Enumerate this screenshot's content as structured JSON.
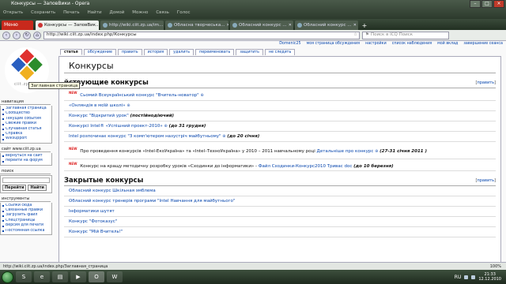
{
  "window": {
    "title": "Конкурсы — ЗаповВики - Opera",
    "controls": [
      "–",
      "□",
      "×"
    ]
  },
  "ghost_toolbar": [
    "Открыть",
    "Сохранить",
    "Печать",
    "Найти",
    "Домой",
    "Можно",
    "Связь",
    "Голос"
  ],
  "tabbar": {
    "menu_label": "Меню",
    "tabs": [
      {
        "label": "Конкурсы — ЗаповВик...",
        "active": true
      },
      {
        "label": "http://wiki.ciit.zp.ua/im...",
        "active": false
      },
      {
        "label": "Обласна творчеська...",
        "active": false
      },
      {
        "label": "Обласний конкурс ...",
        "active": false
      },
      {
        "label": "Обласний конкурс ...",
        "active": false
      }
    ],
    "new_tab": "+"
  },
  "addressbar": {
    "url": "http://wiki.ciit.zp.ua/index.php/Конкурсы",
    "search_placeholder": "Поиск в ICQ Поиск"
  },
  "personal_links": [
    "Domenic25",
    "моя страница обсуждения",
    "настройки",
    "список наблюдения",
    "мой вклад",
    "завершение сеанса"
  ],
  "logo": {
    "brand": "ciit.zp.ua"
  },
  "tooltip": "Заглавная страница",
  "content_tabs": [
    {
      "label": "статья",
      "selected": true
    },
    {
      "label": "обсуждение",
      "selected": false
    },
    {
      "label": "править",
      "selected": false
    },
    {
      "label": "история",
      "selected": false
    },
    {
      "label": "удалить",
      "selected": false
    },
    {
      "label": "переименовать",
      "selected": false
    },
    {
      "label": "защитить",
      "selected": false
    },
    {
      "label": "не следить",
      "selected": false
    }
  ],
  "sidebar": {
    "navigation": {
      "title": "навигация",
      "items": [
        "Заглавная страница",
        "Сообщество",
        "Текущие события",
        "Свежие правки",
        "Случайная статья",
        "Справка",
        "Wiksupport"
      ]
    },
    "site": {
      "title": "сайт www.ciit.zp.ua",
      "items": [
        "вернуться на сайт",
        "перейти на форум"
      ]
    },
    "search": {
      "title": "поиск",
      "go": "Перейти",
      "find": "Найти"
    },
    "tools": {
      "title": "инструменты",
      "items": [
        "Ссылки сюда",
        "Связанные правки",
        "Загрузить файл",
        "Спецстраницы",
        "Версия для печати",
        "Постоянная ссылка"
      ]
    }
  },
  "article": {
    "title": "Конкурсы",
    "edit_label": "править",
    "section_active": {
      "heading": "йствующие конкурсы",
      "rows": [
        {
          "new": true,
          "link": "Сьомий Всеукраїнський конкурс \"Вчитель-новатор\"",
          "ext": "⊕",
          "note": ""
        },
        {
          "new": false,
          "link": "«Онляндія в моїй школі»",
          "ext": "⊕",
          "note": ""
        },
        {
          "new": false,
          "link": "Конкурс \"Відкритий урок\"",
          "ext": "",
          "note": "(постійнодіючий)"
        },
        {
          "new": false,
          "link": "Конкурсі Intel® «Успішний проект-2010»",
          "ext": "⊕",
          "note": "(до 31 грудня)"
        },
        {
          "new": false,
          "link": "Intel розпочинає конкурс \"З комп'ютером назустріч майбутньому\"",
          "ext": "⊕",
          "note": "(до 20 січня)"
        },
        {
          "new": true,
          "pre": "Про проведення конкурсів «Intel-ЕкоУкраїна» та «Intel–ТехноУкраїна» у 2010 – 2011 навчальному році",
          "link": "Детальніше про конкурс",
          "ext": "⊕",
          "note": "(27-31 січня 2011 )"
        },
        {
          "new": true,
          "pre": "Конкурс на кращу методичну розробку уроків «Сходинки до інформатики» -",
          "link": "Файл Сходинки-Конкурс2010 Тривас doc",
          "ext": "",
          "note": "(до 10 березня)"
        }
      ]
    },
    "section_closed": {
      "heading": "Закрытые конкурсы",
      "rows": [
        {
          "link": "Обласний конкурс Шкільная эмблема"
        },
        {
          "link": "Обласний конкурс тренерів програми \"Intel Навчання для майбутнього\""
        },
        {
          "link": "Інформатики шутят"
        },
        {
          "link": "Конкурс \"Фотоказус\""
        },
        {
          "link": "Конкурс \"Мій Вчитель!\""
        }
      ]
    }
  },
  "statusbar": {
    "text": "http://wiki.ciit.zp.ua/index.php/Заглавная_страница",
    "zoom": "100%"
  },
  "taskbar": {
    "time": "21:33",
    "date": "12.12.2010",
    "lang": "RU"
  }
}
